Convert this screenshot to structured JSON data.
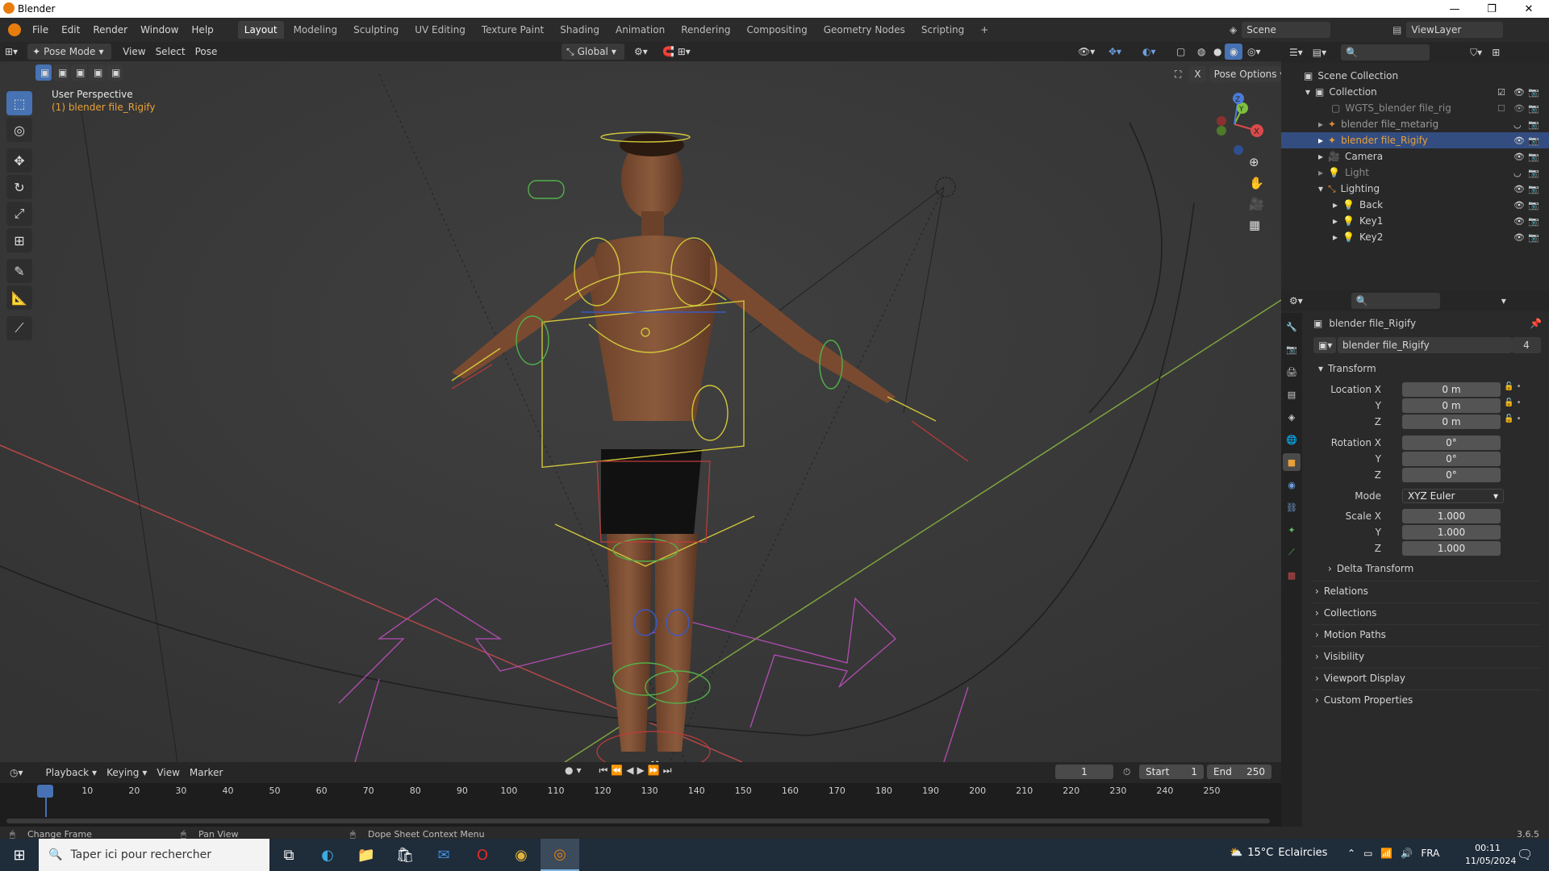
{
  "window": {
    "title": "Blender",
    "minimize_glyph": "—",
    "restore_glyph": "❐",
    "close_glyph": "✕"
  },
  "menu": {
    "file": "File",
    "edit": "Edit",
    "render": "Render",
    "window": "Window",
    "help": "Help"
  },
  "workspaces": [
    "Layout",
    "Modeling",
    "Sculpting",
    "UV Editing",
    "Texture Paint",
    "Shading",
    "Animation",
    "Rendering",
    "Compositing",
    "Geometry Nodes",
    "Scripting"
  ],
  "workspace_add": "+",
  "scene": {
    "scene_name": "Scene",
    "view_layer": "ViewLayer"
  },
  "viewport_header": {
    "mode": "Pose Mode",
    "view": "View",
    "select": "Select",
    "pose": "Pose",
    "orientation": "Global",
    "pose_options": "Pose Options"
  },
  "viewport": {
    "perspective_label": "User Perspective",
    "object_label": "(1) blender file_Rigify"
  },
  "outliner": {
    "search_placeholder": "",
    "items": [
      {
        "label": "Scene Collection"
      },
      {
        "label": "Collection"
      },
      {
        "label": "WGTS_blender file_rig"
      },
      {
        "label": "blender file_metarig"
      },
      {
        "label": "blender file_Rigify"
      },
      {
        "label": "Camera"
      },
      {
        "label": "Light"
      },
      {
        "label": "Lighting"
      },
      {
        "label": "Back"
      },
      {
        "label": "Key1"
      },
      {
        "label": "Key2"
      }
    ]
  },
  "properties": {
    "object_name": "blender file_Rigify",
    "data_name": "blender file_Rigify",
    "data_users": "4",
    "transform_header": "Transform",
    "location": {
      "label_x": "Location X",
      "label_y": "Y",
      "label_z": "Z",
      "x": "0 m",
      "y": "0 m",
      "z": "0 m"
    },
    "rotation": {
      "label_x": "Rotation X",
      "label_y": "Y",
      "label_z": "Z",
      "x": "0°",
      "y": "0°",
      "z": "0°"
    },
    "mode": {
      "label": "Mode",
      "value": "XYZ Euler"
    },
    "scale": {
      "label_x": "Scale X",
      "label_y": "Y",
      "label_z": "Z",
      "x": "1.000",
      "y": "1.000",
      "z": "1.000"
    },
    "delta_transform": "Delta Transform",
    "sections": [
      "Relations",
      "Collections",
      "Motion Paths",
      "Visibility",
      "Viewport Display",
      "Custom Properties"
    ]
  },
  "timeline": {
    "playback": "Playback",
    "keying": "Keying",
    "view": "View",
    "marker": "Marker",
    "current_frame": "1",
    "start_label": "Start",
    "start": "1",
    "end_label": "End",
    "end": "250",
    "ticks": [
      "1",
      "10",
      "20",
      "30",
      "40",
      "50",
      "60",
      "70",
      "80",
      "90",
      "100",
      "110",
      "120",
      "130",
      "140",
      "150",
      "160",
      "170",
      "180",
      "190",
      "200",
      "210",
      "220",
      "230",
      "240",
      "250"
    ]
  },
  "statusbar": {
    "change_frame": "Change Frame",
    "pan_view": "Pan View",
    "context_menu": "Dope Sheet Context Menu",
    "version": "3.6.5"
  },
  "taskbar": {
    "search_placeholder": "Taper ici pour rechercher",
    "weather_temp": "15°C",
    "weather_text": "Eclaircies",
    "language": "FRA",
    "time": "00:11",
    "date": "11/05/2024"
  },
  "colors": {
    "accent": "#4772b3",
    "selected_row": "#334d80",
    "orange": "#e8a03a",
    "x_axis": "#d94a4a",
    "y_axis": "#7fbf3f",
    "z_axis": "#4a7bd9"
  }
}
